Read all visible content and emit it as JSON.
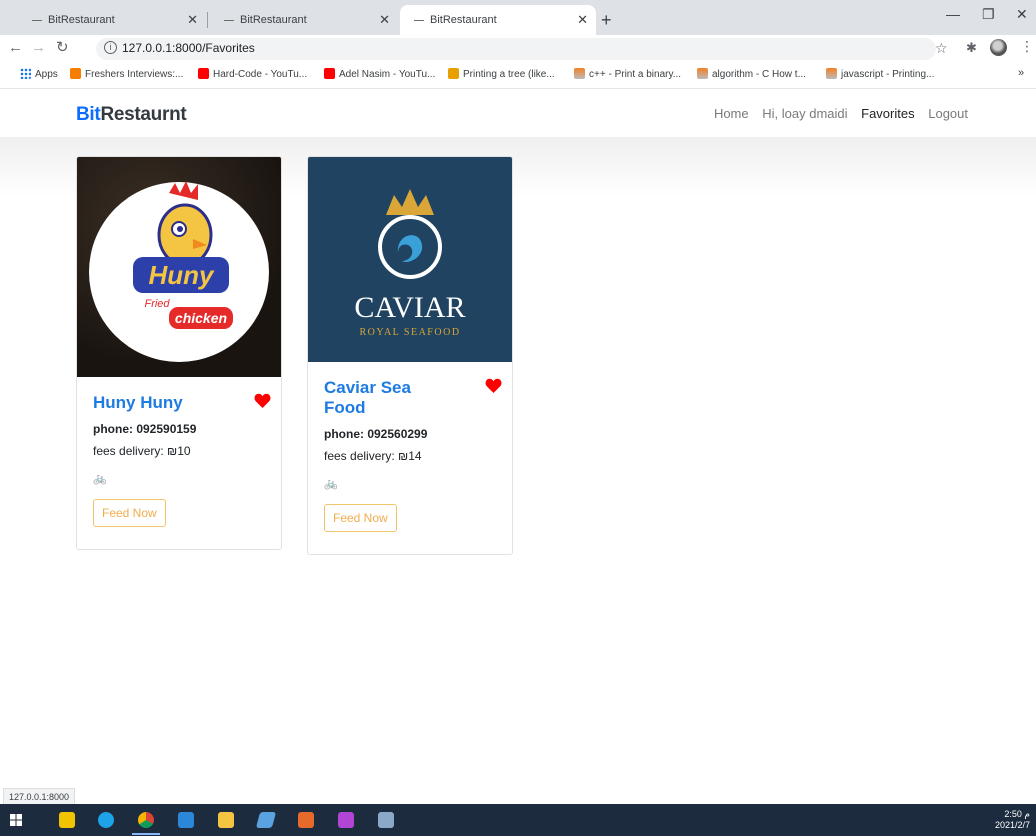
{
  "browser": {
    "tabs": [
      {
        "title": "BitRestaurant",
        "active": false
      },
      {
        "title": "BitRestaurant",
        "active": false
      },
      {
        "title": "BitRestaurant",
        "active": true
      }
    ],
    "url": "127.0.0.1:8000/Favorites",
    "bookmarks": [
      {
        "label": "Apps",
        "icon": "apps-grid-icon"
      },
      {
        "label": "Freshers Interviews:...",
        "icon": "blogger-icon"
      },
      {
        "label": "Hard-Code - YouTu...",
        "icon": "youtube-icon"
      },
      {
        "label": "Adel Nasim - YouTu...",
        "icon": "youtube-icon"
      },
      {
        "label": "Printing a tree (like...",
        "icon": "tree-icon"
      },
      {
        "label": "c++ - Print a binary...",
        "icon": "stackoverflow-icon"
      },
      {
        "label": "algorithm - C How t...",
        "icon": "stackoverflow-icon"
      },
      {
        "label": "javascript - Printing...",
        "icon": "stackoverflow-icon"
      }
    ],
    "status_url": "127.0.0.1:8000"
  },
  "site": {
    "brand_prefix": "Bit",
    "brand_rest": "Restaurnt",
    "nav": {
      "home": "Home",
      "greeting": "Hi, loay dmaidi",
      "favorites": "Favorites",
      "logout": "Logout"
    }
  },
  "restaurants": [
    {
      "name": "Huny Huny",
      "phone": "phone: 092590159",
      "fees": "fees delivery: ₪10",
      "delivery_icon": "🚲",
      "button": "Feed Now",
      "logo_text_1": "Huny",
      "logo_text_2": "Fried",
      "logo_text_3": "chicken"
    },
    {
      "name": "Caviar Sea Food",
      "phone": "phone: 092560299",
      "fees": "fees delivery: ₪14",
      "delivery_icon": "🚲",
      "button": "Feed Now",
      "logo_text_1": "CAVIAR",
      "logo_text_2": "ROYAL SEAFOOD"
    }
  ],
  "taskbar": {
    "time": "2:50 م",
    "date": "2021/2/7"
  },
  "colors": {
    "link_blue": "#1e7be2",
    "heart_red": "#ff0000",
    "button_orange": "#f0ad4e"
  }
}
